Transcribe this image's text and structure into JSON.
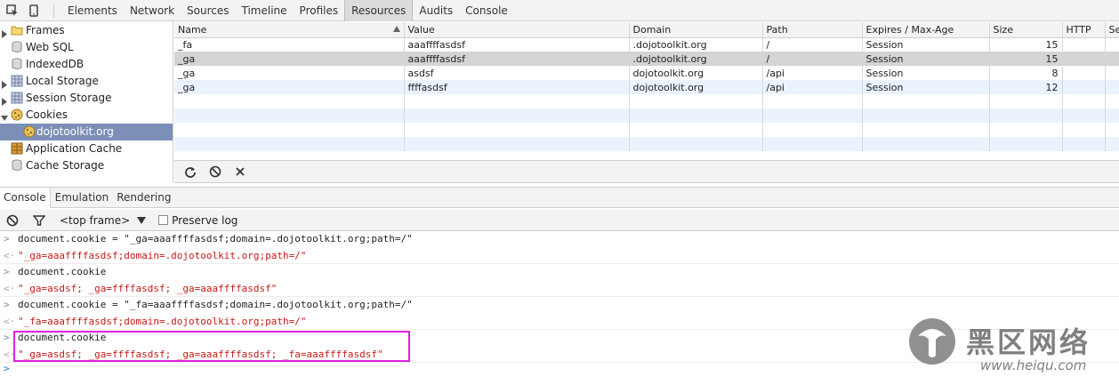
{
  "toolbar": {
    "tabs": [
      {
        "label": "Elements",
        "active": false
      },
      {
        "label": "Network",
        "active": false
      },
      {
        "label": "Sources",
        "active": false
      },
      {
        "label": "Timeline",
        "active": false
      },
      {
        "label": "Profiles",
        "active": false
      },
      {
        "label": "Resources",
        "active": true
      },
      {
        "label": "Audits",
        "active": false
      },
      {
        "label": "Console",
        "active": false
      }
    ],
    "icons": [
      "inspect-element-icon",
      "device-mode-icon"
    ]
  },
  "sidebar": {
    "items": [
      {
        "label": "Frames",
        "icon": "folder-icon",
        "expanded": false,
        "has_arrow": true
      },
      {
        "label": "Web SQL",
        "icon": "database-icon",
        "has_arrow": false
      },
      {
        "label": "IndexedDB",
        "icon": "database-icon",
        "has_arrow": false
      },
      {
        "label": "Local Storage",
        "icon": "grid-storage-icon",
        "has_arrow": true
      },
      {
        "label": "Session Storage",
        "icon": "grid-storage-icon",
        "has_arrow": true
      },
      {
        "label": "Cookies",
        "icon": "cookie-icon",
        "expanded": true,
        "has_arrow": true
      },
      {
        "label": "dojotoolkit.org",
        "icon": "cookie-icon",
        "child": true,
        "selected": true
      },
      {
        "label": "Application Cache",
        "icon": "app-cache-icon",
        "has_arrow": false
      },
      {
        "label": "Cache Storage",
        "icon": "database-icon",
        "has_arrow": false
      }
    ]
  },
  "cookies": {
    "columns": [
      "Name",
      "Value",
      "Domain",
      "Path",
      "Expires / Max-Age",
      "Size",
      "HTTP",
      "Sec"
    ],
    "rows": [
      {
        "name": "_fa",
        "value": "aaaffffasdsf",
        "domain": ".dojotoolkit.org",
        "path": "/",
        "expires": "Session",
        "size": "15",
        "http": "",
        "sec": ""
      },
      {
        "name": "_ga",
        "value": "aaaffffasdsf",
        "domain": ".dojotoolkit.org",
        "path": "/",
        "expires": "Session",
        "size": "15",
        "http": "",
        "sec": ""
      },
      {
        "name": "_ga",
        "value": "asdsf",
        "domain": "dojotoolkit.org",
        "path": "/api",
        "expires": "Session",
        "size": "8",
        "http": "",
        "sec": ""
      },
      {
        "name": "_ga",
        "value": "ffffasdsf",
        "domain": "dojotoolkit.org",
        "path": "/api",
        "expires": "Session",
        "size": "12",
        "http": "",
        "sec": ""
      }
    ],
    "selected_row": 1,
    "status_buttons": [
      "refresh-icon",
      "clear-icon",
      "delete-icon"
    ]
  },
  "drawer": {
    "tabs": [
      {
        "label": "Console",
        "active": true
      },
      {
        "label": "Emulation",
        "active": false
      },
      {
        "label": "Rendering",
        "active": false
      }
    ]
  },
  "console_toolbar": {
    "frame": "<top frame>",
    "preserve_log_label": "Preserve log",
    "preserve_log_checked": false
  },
  "console": {
    "messages": [
      {
        "kind": "input",
        "prefix": ">",
        "text": "document.cookie = \"_ga=aaaffffasdsf;domain=.dojotoolkit.org;path=/\""
      },
      {
        "kind": "result",
        "prefix": "<·",
        "text": "\"_ga=aaaffffasdsf;domain=.dojotoolkit.org;path=/\""
      },
      {
        "kind": "input",
        "prefix": ">",
        "text": "document.cookie"
      },
      {
        "kind": "result",
        "prefix": "<·",
        "text": "\"_ga=asdsf; _ga=ffffasdsf; _ga=aaaffffasdsf\""
      },
      {
        "kind": "input",
        "prefix": ">",
        "text": "document.cookie = \"_fa=aaaffffasdsf;domain=.dojotoolkit.org;path=/\""
      },
      {
        "kind": "result",
        "prefix": "<·",
        "text": "\"_fa=aaaffffasdsf;domain=.dojotoolkit.org;path=/\""
      },
      {
        "kind": "input",
        "prefix": ">",
        "text": "document.cookie"
      },
      {
        "kind": "result",
        "prefix": "<·",
        "text": "\"_ga=asdsf; _ga=ffffasdsf; _ga=aaaffffasdsf; _fa=aaaffffasdsf\""
      }
    ],
    "prompt": ">"
  },
  "watermark": {
    "text": "黑区网络",
    "url": "www.heiqu.com"
  },
  "colors": {
    "highlight_border": "#e020e0",
    "selected_sidebar": "#7b8fb7",
    "result_text": "#c41a16"
  }
}
